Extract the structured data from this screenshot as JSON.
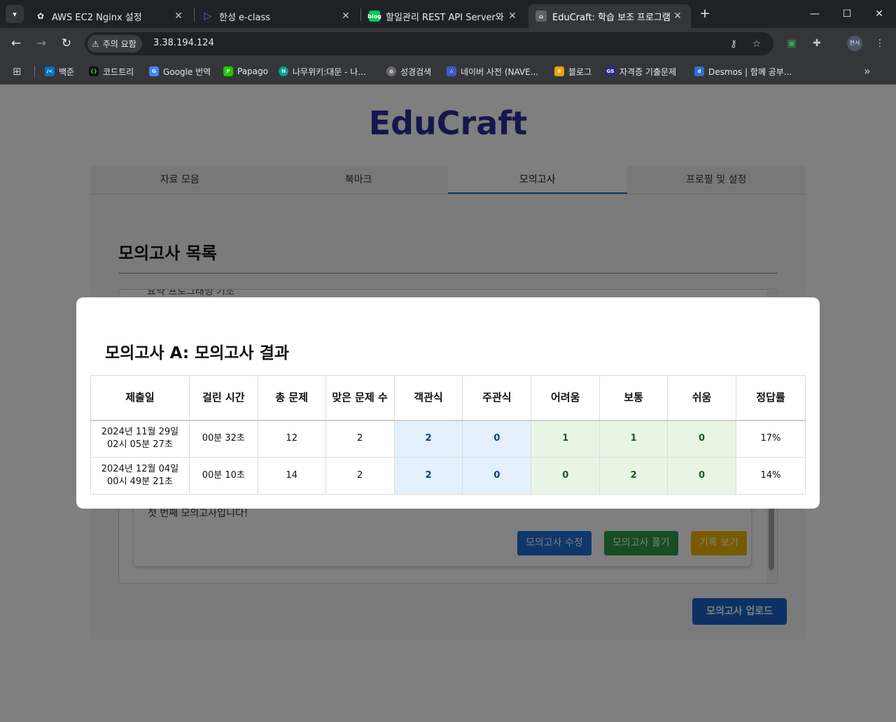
{
  "browser": {
    "tabs": [
      {
        "title": "AWS EC2 Nginx 설정",
        "active": false
      },
      {
        "title": "한성 e-class",
        "active": false
      },
      {
        "title": "할일관리 REST API Server와 Cl",
        "active": false
      },
      {
        "title": "EduCraft: 학습 보조 프로그램",
        "active": true
      }
    ],
    "security_chip": "주의 요함",
    "url": "3.38.194.124",
    "profile_label": "현서",
    "bookmarks": [
      {
        "label": "백준",
        "color": "#0076c0"
      },
      {
        "label": "코드트리",
        "color": "#111111"
      },
      {
        "label": "Google 번역",
        "color": "#4285f4"
      },
      {
        "label": "Papago",
        "color": "#1ec800"
      },
      {
        "label": "나무위키:대문 - 나...",
        "color": "#00a495"
      },
      {
        "label": "성경검색",
        "color": "#6b6b6b"
      },
      {
        "label": "네이버 사전 (NAVE...",
        "color": "#3b5cc4"
      },
      {
        "label": "블로그",
        "color": "#f0a000"
      },
      {
        "label": "자격증 기출문제",
        "color": "#2a2a8a"
      },
      {
        "label": "Desmos | 함께 공부...",
        "color": "#2f6fd6"
      }
    ]
  },
  "app": {
    "brand": "EduCraft",
    "nav": [
      {
        "label": "자료 모음",
        "active": false
      },
      {
        "label": "북마크",
        "active": false
      },
      {
        "label": "모의고사",
        "active": true
      },
      {
        "label": "프로필 및 설정",
        "active": false
      }
    ],
    "panel_title": "모의고사 목록",
    "item_partial_top": "요약 프로그래밍 기초",
    "item_description": "첫 번째 모의고사입니다!",
    "buttons": {
      "edit": "모의고사 수정",
      "solve": "모의고사 풀기",
      "record": "기록 보기",
      "upload": "모의고사 업로드"
    }
  },
  "modal": {
    "title": "모의고사 A: 모의고사 결과",
    "columns": [
      "제출일",
      "걸린 시간",
      "총 문제",
      "맞은 문제 수",
      "객관식",
      "주관식",
      "어려움",
      "보통",
      "쉬움",
      "정답률"
    ],
    "rows": [
      {
        "date": "2024년 11월 29일 02시 05분 27초",
        "duration": "00분 32초",
        "total": "12",
        "correct": "2",
        "objective": "2",
        "subjective": "0",
        "hard": "1",
        "normal": "1",
        "easy": "0",
        "rate": "17%"
      },
      {
        "date": "2024년 12월 04일 00시 49분 21초",
        "duration": "00분 10초",
        "total": "14",
        "correct": "2",
        "objective": "2",
        "subjective": "0",
        "hard": "0",
        "normal": "2",
        "easy": "0",
        "rate": "14%"
      }
    ]
  }
}
